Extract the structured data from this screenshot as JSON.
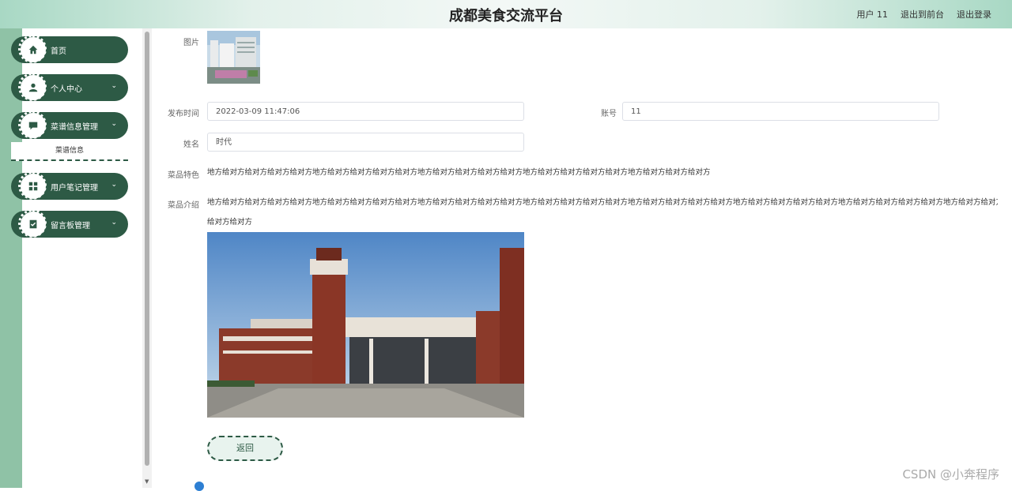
{
  "header": {
    "title": "成都美食交流平台",
    "user": "用户 11",
    "links": [
      "退出到前台",
      "退出登录"
    ]
  },
  "sidebar": {
    "items": [
      {
        "label": "首页",
        "icon": "home-icon",
        "chevron": ""
      },
      {
        "label": "个人中心",
        "icon": "person-icon",
        "chevron": "⌄"
      },
      {
        "label": "菜谱信息管理",
        "icon": "chat-icon",
        "chevron": "⌄"
      },
      {
        "label": "用户笔记管理",
        "icon": "grid-icon",
        "chevron": "⌄"
      },
      {
        "label": "留言板管理",
        "icon": "clipboard-icon",
        "chevron": "⌄"
      }
    ],
    "sub_item": "菜谱信息"
  },
  "form": {
    "image_label": "图片",
    "publish_time_label": "发布时间",
    "publish_time_value": "2022-03-09 11:47:06",
    "account_label": "账号",
    "account_value": "11",
    "name_label": "姓名",
    "name_value": "时代",
    "feature_label": "菜品特色",
    "feature_text": "地方给对方给对方给对方给对方地方给对方给对方给对方给对方地方给对方给对方给对方给对方地方给对方给对方给对方给对方地方给对方给对方给对方",
    "intro_label": "菜品介绍",
    "intro_text_line1": "地方给对方给对方给对方给对方地方给对方给对方给对方给对方地方给对方给对方给对方给对方地方给对方给对方给对方给对方地方给对方给对方给对方给对方地方给对方给对方给对方给对方地方给对方给对方给对方给对方地方给对方给对方给对方给对方地方给对方给对方",
    "intro_text_line2": "给对方给对方",
    "back_button": "返回"
  },
  "watermark": "CSDN @小奔程序",
  "colors": {
    "primary": "#2d5a45",
    "header": "#a8d8c4"
  }
}
